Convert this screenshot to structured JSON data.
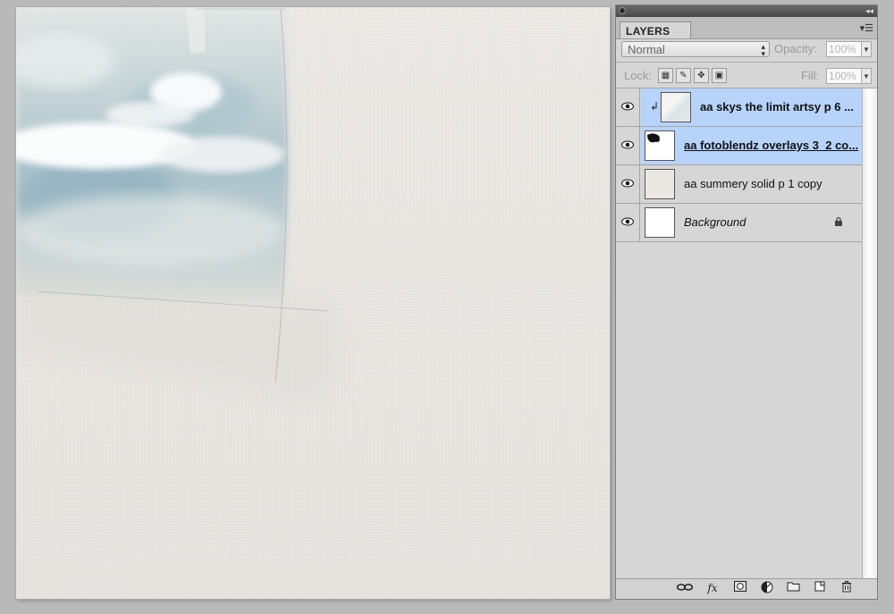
{
  "panel": {
    "tab_label": "LAYERS",
    "blend_mode": "Normal",
    "opacity_label": "Opacity:",
    "opacity_value": "100%",
    "lock_label": "Lock:",
    "fill_label": "Fill:",
    "fill_value": "100%"
  },
  "layers": [
    {
      "name": "aa skys the limit artsy p 6 ...",
      "selected": true,
      "clipped": true,
      "bold": true
    },
    {
      "name": "aa fotoblendz overlays 3_2 co...",
      "selected": true,
      "clipped": false,
      "bold": true,
      "underline": true
    },
    {
      "name": "aa summery solid p 1 copy",
      "selected": false
    },
    {
      "name": "Background",
      "selected": false,
      "italic": true,
      "locked": true
    }
  ],
  "footer_icons": [
    "link-layers-icon",
    "fx-icon",
    "add-mask-icon",
    "adjustment-layer-icon",
    "group-folder-icon",
    "new-layer-icon",
    "trash-icon"
  ],
  "colors": {
    "selection": "#b7d3fa",
    "panel_bg": "#d6d6d6",
    "canvas_paper": "#e9e6e2"
  }
}
